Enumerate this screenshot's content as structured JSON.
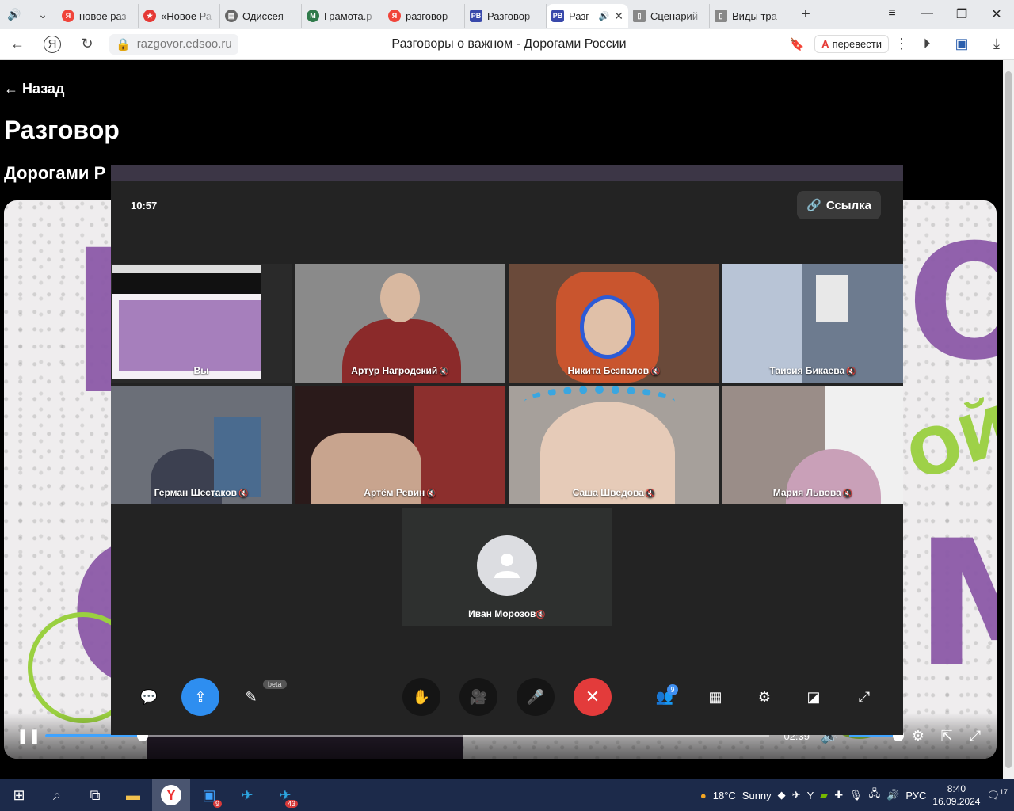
{
  "browser": {
    "tabs": [
      {
        "label": "новое раз",
        "favicon": "yandex",
        "color": "#f0443a"
      },
      {
        "label": "«Новое Ра",
        "favicon": "star",
        "color": "#e53935"
      },
      {
        "label": "Одиссея -",
        "favicon": "book",
        "color": "#555555"
      },
      {
        "label": "Грамота.р",
        "favicon": "gramota",
        "color": "#2f7a4a"
      },
      {
        "label": "разговор",
        "favicon": "yandex",
        "color": "#f0443a"
      },
      {
        "label": "Разговор",
        "favicon": "PB",
        "color": "#3949ab"
      },
      {
        "label": "Разг",
        "favicon": "PB",
        "color": "#3949ab",
        "active": true
      },
      {
        "label": "Сценарий",
        "favicon": "doc",
        "color": "#555555"
      },
      {
        "label": "Виды тра",
        "favicon": "doc",
        "color": "#555555"
      }
    ],
    "url": "razgovor.edsoo.ru",
    "page_title": "Разговоры о важном - Дорогами России",
    "translate_label": "перевести"
  },
  "page": {
    "back_link": "← Назад",
    "title": "Разговор",
    "subtitle": "Дорогами Р"
  },
  "video": {
    "time_left": "-02:39",
    "progress": 0.135,
    "volume": 1.0
  },
  "call": {
    "clock": "10:57",
    "link_label": "Ссылка",
    "participants": [
      {
        "name": "Вы",
        "bg": "#2a2a2a"
      },
      {
        "name": "Артур Нагродский",
        "bg": "#8a8a8a"
      },
      {
        "name": "Никита Безпалов",
        "bg": "#7a5a4a"
      },
      {
        "name": "Таисия Бикаева",
        "bg": "#6d7b8f"
      },
      {
        "name": "Герман Шестаков",
        "bg": "#6b6f78"
      },
      {
        "name": "Артём Ревин",
        "bg": "#6a2d2b"
      },
      {
        "name": "Саша Шведова",
        "bg": "#a6a09b"
      },
      {
        "name": "Мария Львова",
        "bg": "#9a8d88"
      }
    ],
    "avatar_participant": "Иван Морозов",
    "beta_label": "beta",
    "participants_count": "9"
  },
  "taskbar": {
    "weather_temp": "18°C",
    "weather_text": "Sunny",
    "lang": "РУС",
    "time": "8:40",
    "date": "16.09.2024",
    "notifications": "17",
    "telegram_count": "43",
    "app_badge": "9"
  }
}
